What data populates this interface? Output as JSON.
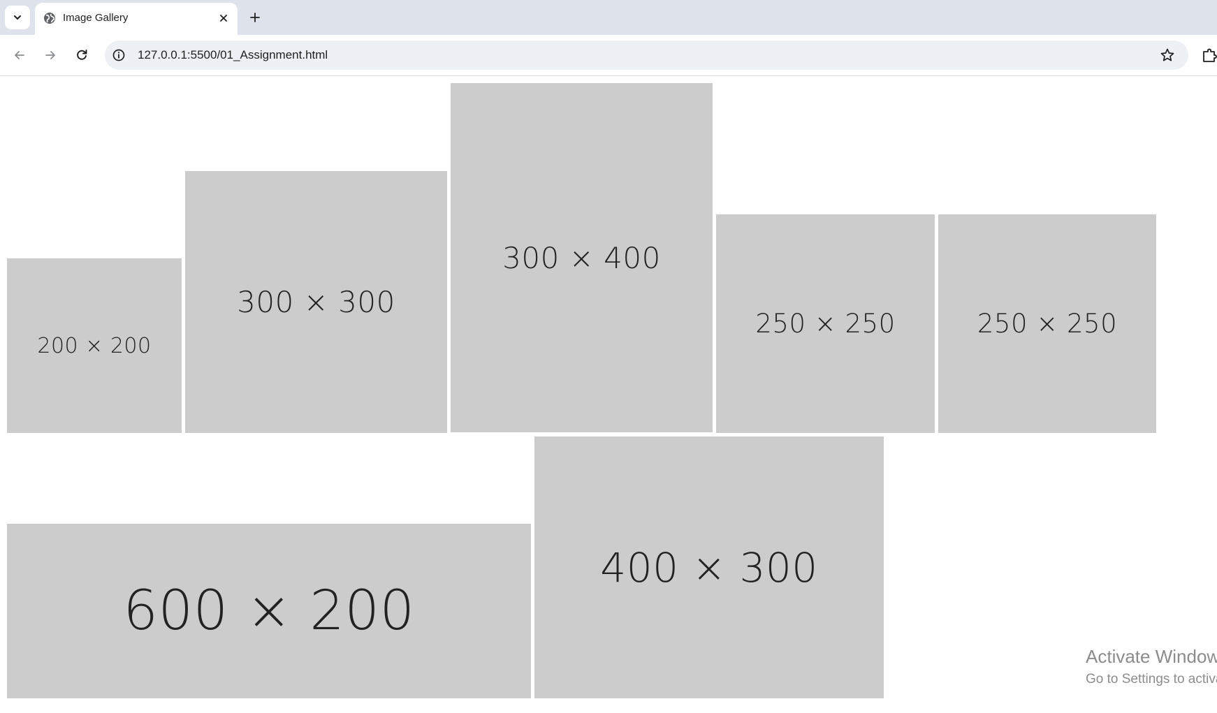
{
  "browser": {
    "tab_title": "Image Gallery",
    "url": "127.0.0.1:5500/01_Assignment.html",
    "new_tab_symbol": "+"
  },
  "icons": {
    "tab_search": "chevron-down-icon",
    "favicon": "globe-icon",
    "tab_close": "close-icon",
    "new_tab": "plus-icon",
    "back": "back-arrow-icon",
    "forward": "forward-arrow-icon",
    "reload": "reload-icon",
    "site_info": "info-icon",
    "bookmark": "star-icon",
    "extensions": "puzzle-icon"
  },
  "gallery": {
    "images": [
      {
        "label": "200 × 200"
      },
      {
        "label": "300 × 300"
      },
      {
        "label": "300 × 400"
      },
      {
        "label": "250 × 250"
      },
      {
        "label": "250 × 250"
      },
      {
        "label": "600 × 200"
      },
      {
        "label": "400 × 300"
      }
    ]
  },
  "watermark": {
    "line1": "Activate Windows",
    "line2": "Go to Settings to activate Windows."
  },
  "colors": {
    "placeholder_bg": "#cccccc",
    "placeholder_text": "#222222",
    "tabstrip_bg": "#dee3eb",
    "omnibox_bg": "#edf0f5"
  }
}
